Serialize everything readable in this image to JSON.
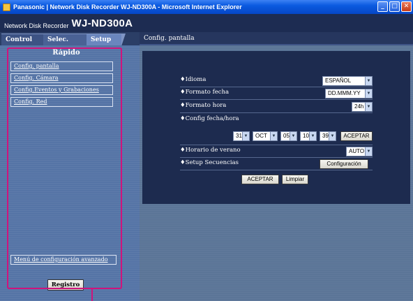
{
  "window": {
    "title": "Panasonic | Network Disk Recorder WJ-ND300A - Microsoft Internet Explorer",
    "minimize": "_",
    "maximize": "□",
    "close": "✕"
  },
  "header": {
    "subtitle": "Network Disk Recorder",
    "model": "WJ-ND300A"
  },
  "tabs": [
    {
      "label": "Control"
    },
    {
      "label": "Selec. Cam."
    },
    {
      "label": "Setup"
    }
  ],
  "sidebar": {
    "title": "Rápido",
    "links": [
      {
        "label": "Config. pantalla"
      },
      {
        "label": "Config. Cámara"
      },
      {
        "label": "Config.Eventos y Grabaciones"
      },
      {
        "label": "Config. Red"
      }
    ],
    "advanced_link": "Menú de configuración avanzado",
    "register_button": "Registro"
  },
  "main": {
    "title": "Config. pantalla",
    "rows": {
      "language": {
        "label": "♦Idioma",
        "value": "ESPAÑOL"
      },
      "date_format": {
        "label": "♦Formato fecha",
        "value": "DD.MMM.YY"
      },
      "time_format": {
        "label": "♦Formato hora",
        "value": "24h"
      },
      "datetime": {
        "label": "♦Config fecha/hora",
        "day": "31",
        "month": "OCT",
        "year": "05",
        "hour": "10",
        "minute": "39",
        "accept": "ACEPTAR"
      },
      "dst": {
        "label": "♦Horario de verano",
        "value": "AUTO"
      },
      "sequence": {
        "label": "♦Setup Secuencias",
        "button": "Configuración"
      }
    },
    "accept_button": "ACEPTAR",
    "clear_button": "Limpiar"
  },
  "colors": {
    "callout": "#d0137c",
    "header_bg": "#1d2c52",
    "panel_bg": "#1d2b4f"
  }
}
